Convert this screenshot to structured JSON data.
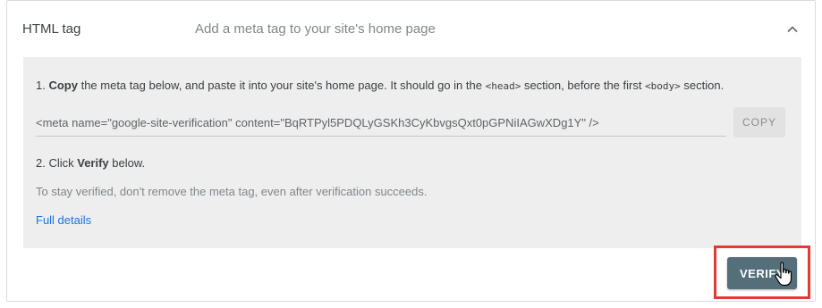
{
  "method": {
    "title": "HTML tag",
    "description": "Add a meta tag to your site's home page"
  },
  "instructions": {
    "step1_number": "1.",
    "step1_bold": "Copy",
    "step1_text_a": " the meta tag below, and paste it into your site's home page. It should go in the ",
    "step1_code_head": "<head>",
    "step1_text_b": " section, before the first ",
    "step1_code_body": "<body>",
    "step1_text_c": " section.",
    "meta_tag": "<meta name=\"google-site-verification\" content=\"BqRTPyl5PDQLyGSKh3CyKbvgsQxt0pGPNiIAGwXDg1Y\" />",
    "copy_label": "COPY",
    "step2_number": "2. Click ",
    "step2_bold": "Verify",
    "step2_text": " below.",
    "note": "To stay verified, don't remove the meta tag, even after verification succeeds.",
    "details_link": "Full details"
  },
  "actions": {
    "verify_label": "VERIFY"
  },
  "colors": {
    "panel_bg": "#eeeeee",
    "verify_bg": "#546e7a",
    "link": "#1a73e8",
    "highlight": "#e53935"
  },
  "icons": {
    "collapse": "chevron-up-icon",
    "pointer": "hand-cursor-icon"
  }
}
